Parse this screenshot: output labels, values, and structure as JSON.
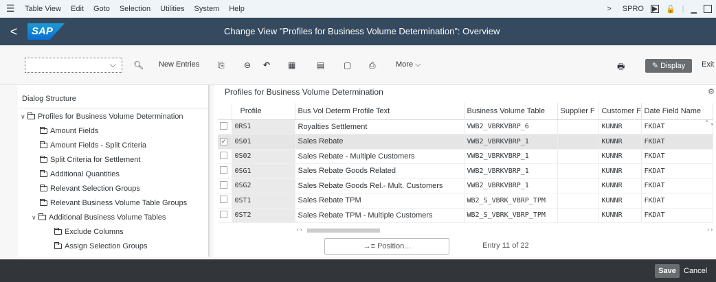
{
  "menubar": {
    "items": [
      "Table View",
      "Edit",
      "Goto",
      "Selection",
      "Utilities",
      "System",
      "Help"
    ],
    "transaction": "SPRO",
    "forward_glyph": ">"
  },
  "titlebar": {
    "back_glyph": "<",
    "logo": "SAP",
    "title": "Change View \"Profiles for Business Volume Determination\": Overview"
  },
  "toolbar": {
    "command_value": "",
    "new_entries": "New Entries",
    "more": "More",
    "display": "Display",
    "exit": "Exit"
  },
  "dialog": {
    "header": "Dialog Structure",
    "items": [
      "Profiles for Business Volume Determination",
      "Amount Fields",
      "Amount Fields - Split Criteria",
      "Split Criteria for Settlement",
      "Additional Quantities",
      "Relevant Selection Groups",
      "Relevant Business Volume Table Groups",
      "Additional Business Volume Tables",
      "Exclude Columns",
      "Assign Selection Groups"
    ]
  },
  "table": {
    "title": "Profiles for Business Volume Determination",
    "columns": [
      "Profile",
      "Bus Vol Determ Profile Text",
      "Business Volume Table",
      "Supplier F",
      "Customer F",
      "Date Field Name"
    ],
    "rows": [
      {
        "profile": "0RS1",
        "text": "Royalties Settlement",
        "bvtable": "VWB2_VBRKVBRP_6",
        "supplier": "",
        "customer": "KUNNR",
        "date": "FKDAT",
        "checked": false
      },
      {
        "profile": "0S01",
        "text": "Sales Rebate",
        "bvtable": "VWB2_VBRKVBRP_1",
        "supplier": "",
        "customer": "KUNNR",
        "date": "FKDAT",
        "checked": true
      },
      {
        "profile": "0S02",
        "text": "Sales Rebate - Multiple Customers",
        "bvtable": "VWB2_VBRKVBRP_1",
        "supplier": "",
        "customer": "KUNNR",
        "date": "FKDAT",
        "checked": false
      },
      {
        "profile": "0SG1",
        "text": "Sales Rebate Goods Related",
        "bvtable": "VWB2_VBRKVBRP_1",
        "supplier": "",
        "customer": "KUNNR",
        "date": "FKDAT",
        "checked": false
      },
      {
        "profile": "0SG2",
        "text": "Sales Rebate Goods Rel.- Mult. Customers",
        "bvtable": "VWB2_VBRKVBRP_1",
        "supplier": "",
        "customer": "KUNNR",
        "date": "FKDAT",
        "checked": false
      },
      {
        "profile": "0ST1",
        "text": "Sales Rebate TPM",
        "bvtable": "WB2_S_VBRK_VBRP_TPM",
        "supplier": "",
        "customer": "KUNNR",
        "date": "FKDAT",
        "checked": false
      },
      {
        "profile": "0ST2",
        "text": "Sales Rebate TPM - Multiple Customers",
        "bvtable": "WB2_S_VBRK_VBRP_TPM",
        "supplier": "",
        "customer": "KUNNR",
        "date": "FKDAT",
        "checked": false
      }
    ],
    "position_label": "Position...",
    "entry_text": "Entry 11 of 22"
  },
  "footer": {
    "save": "Save",
    "cancel": "Cancel"
  },
  "colors": {
    "shell": "#354a5f",
    "footer": "#32363a",
    "button": "#6a6d70"
  }
}
